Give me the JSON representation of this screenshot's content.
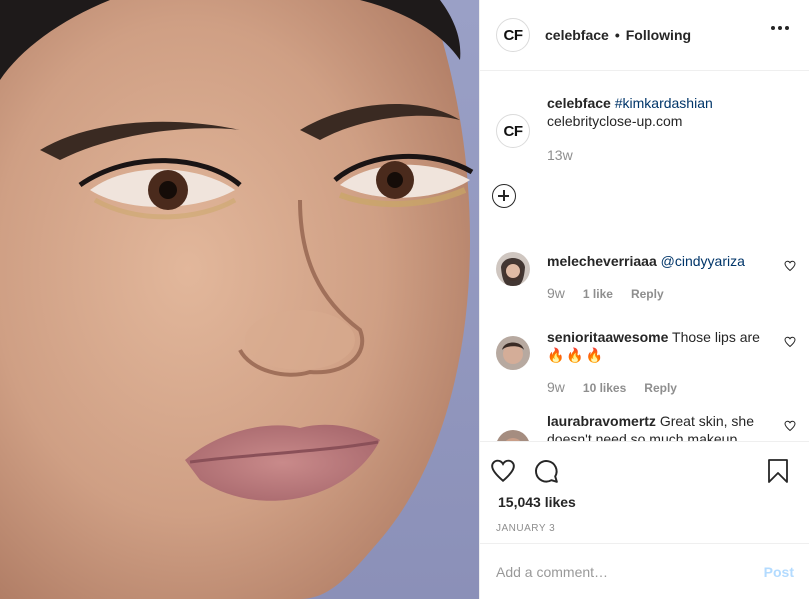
{
  "post": {
    "author": "celebface",
    "author_initials": "CF",
    "follow_separator": "•",
    "follow_status": "Following",
    "image_alt": "Close-up portrait photo"
  },
  "caption": {
    "username": "celebface",
    "hashtag": "#kimkardashian",
    "text": "celebrityclose-up.com",
    "time": "13w"
  },
  "comments": [
    {
      "username": "melecheverriaaa",
      "mention": "@cindyyariza",
      "text": "",
      "time": "9w",
      "likes": "1 like",
      "reply": "Reply"
    },
    {
      "username": "senioritaawesome",
      "mention": "",
      "text": "Those lips are",
      "emoji": "🔥🔥🔥",
      "time": "9w",
      "likes": "10 likes",
      "reply": "Reply"
    },
    {
      "username": "laurabravomertz",
      "mention": "",
      "text": "Great skin, she doesn't need so much makeup",
      "time": "",
      "likes": "",
      "reply": ""
    }
  ],
  "actions": {
    "likes": "15,043 likes",
    "date": "JANUARY 3"
  },
  "add_comment": {
    "placeholder": "Add a comment…",
    "post_label": "Post"
  },
  "colors": {
    "link": "#003569",
    "muted": "#8e8e8e",
    "post_disabled": "#b3dbff",
    "divider": "#efefef"
  }
}
